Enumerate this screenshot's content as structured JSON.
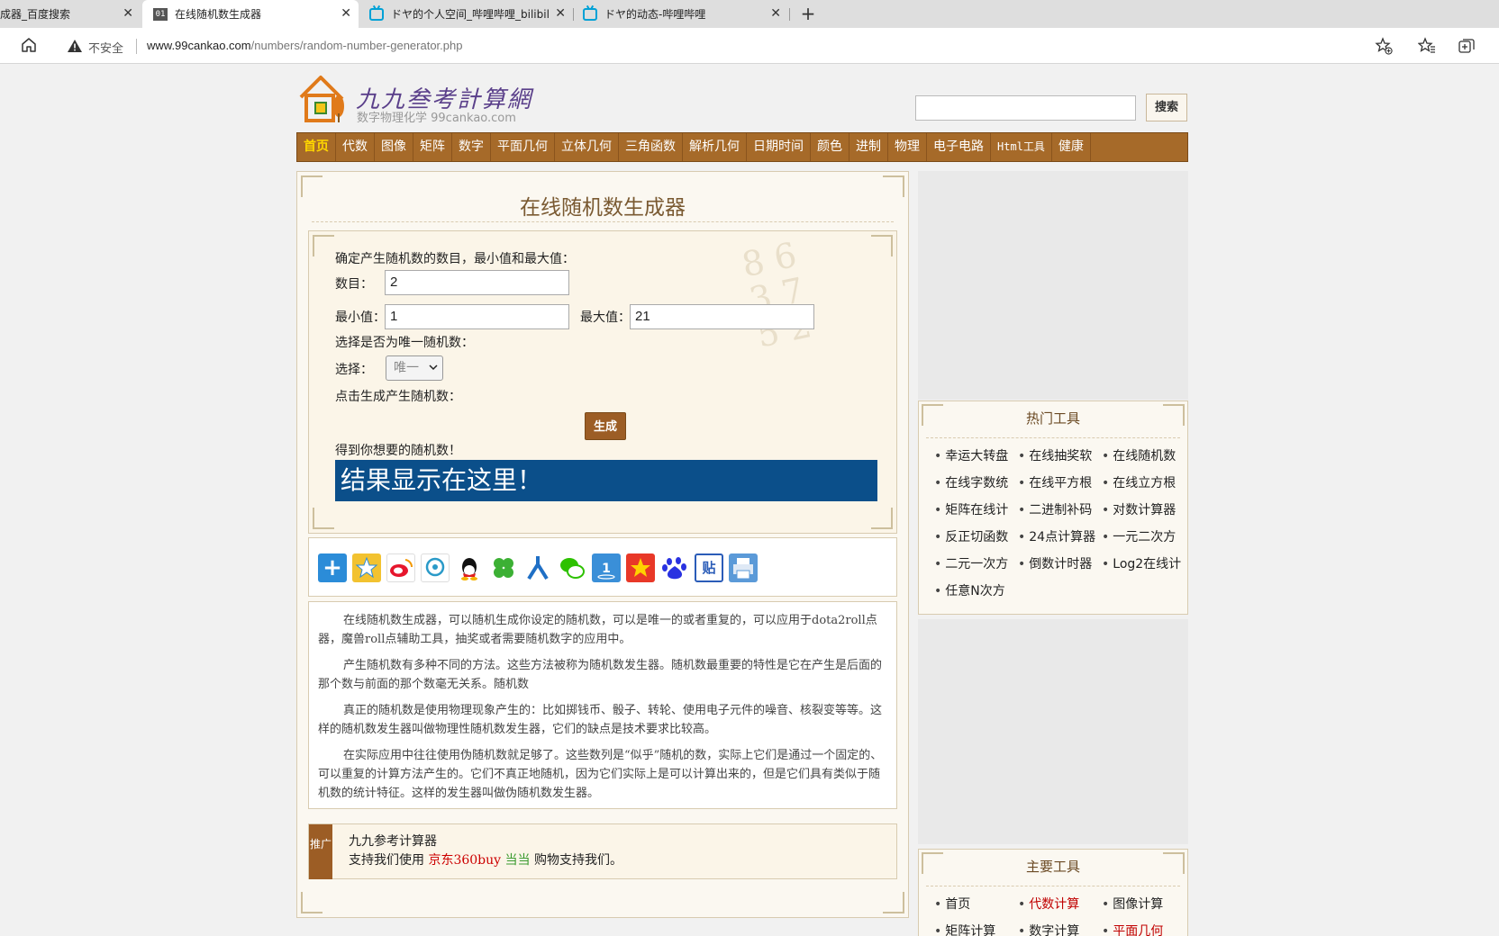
{
  "browser": {
    "tabs": [
      {
        "title": "生成器_百度搜索",
        "active": false
      },
      {
        "title": "在线随机数生成器",
        "active": true
      },
      {
        "title": "ドヤ的个人空间_哔哩哔哩_bilibili",
        "active": false
      },
      {
        "title": "ドヤ的动态-哔哩哔哩",
        "active": false
      }
    ],
    "favicon_01": "01",
    "close_glyph": "✕",
    "new_tab_glyph": "+",
    "security_label": "不安全",
    "url_host": "www.99cankao.com",
    "url_path": "/numbers/random-number-generator.php"
  },
  "site": {
    "logo_title": "九九叁考計算網",
    "logo_sub": "数字物理化学 99cankao.com",
    "search_placeholder": "",
    "search_button": "搜索",
    "nav": [
      "首页",
      "代数",
      "图像",
      "矩阵",
      "数字",
      "平面几何",
      "立体几何",
      "三角函数",
      "解析几何",
      "日期时间",
      "颜色",
      "进制",
      "物理",
      "电子电路",
      "Html工具",
      "健康"
    ],
    "nav_active_index": 0
  },
  "main": {
    "title": "在线随机数生成器",
    "intro": "确定产生随机数的数目，最小值和最大值：",
    "count_label": "数目：",
    "count_value": "2",
    "min_label": "最小值：",
    "min_value": "1",
    "max_label": "最大值：",
    "max_value": "21",
    "unique_question": "选择是否为唯一随机数：",
    "select_label": "选择：",
    "select_value": "唯一",
    "click_prompt": "点击生成产生随机数：",
    "generate_button": "生成",
    "result_label": "得到你想要的随机数！",
    "result_text": "结果显示在这里！",
    "share_icons": [
      "share-plus-icon",
      "qzone-icon",
      "weibo-icon",
      "tencent-weibo-icon",
      "qq-icon",
      "clover-icon",
      "renren-icon",
      "wechat-icon",
      "counter-icon",
      "star-icon",
      "baidu-icon",
      "tieba-icon",
      "print-icon"
    ],
    "tieba_glyph": "贴",
    "paragraphs": [
      "在线随机数生成器，可以随机生成你设定的随机数，可以是唯一的或者重复的，可以应用于dota2roll点器，魔兽roll点辅助工具，抽奖或者需要随机数字的应用中。",
      "产生随机数有多种不同的方法。这些方法被称为随机数发生器。随机数最重要的特性是它在产生是后面的那个数与前面的那个数毫无关系。随机数",
      "真正的随机数是使用物理现象产生的：比如掷钱币、骰子、转轮、使用电子元件的噪音、核裂变等等。这样的随机数发生器叫做物理性随机数发生器，它们的缺点是技术要求比较高。",
      "在实际应用中往往使用伪随机数就足够了。这些数列是“似乎”随机的数，实际上它们是通过一个固定的、可以重复的计算方法产生的。它们不真正地随机，因为它们实际上是可以计算出来的，但是它们具有类似于随机数的统计特征。这样的发生器叫做伪随机数发生器。"
    ],
    "promo_tag": "推广",
    "promo_name": "九九参考计算器",
    "promo_prefix": "支持我们使用",
    "promo_jd": "京东360buy",
    "promo_dd": "当当",
    "promo_suffix": "购物支持我们。"
  },
  "sidebar": {
    "hot_title": "热门工具",
    "hot_items": [
      "幸运大转盘",
      "在线抽奖软",
      "在线随机数",
      "在线字数统",
      "在线平方根",
      "在线立方根",
      "矩阵在线计",
      "二进制补码",
      "对数计算器",
      "反正切函数",
      "24点计算器",
      "一元二次方",
      "二元一次方",
      "倒数计时器",
      "Log2在线计",
      "任意N次方"
    ],
    "main_title": "主要工具",
    "main_items": [
      "首页",
      "代数计算",
      "图像计算",
      "矩阵计算",
      "数字计算",
      "平面几何"
    ],
    "main_red_indices": [
      1,
      5
    ]
  },
  "colors": {
    "nav_bg": "#a66a29",
    "nav_active": "#ffd700",
    "result_bg": "#0b4f8a",
    "button_brown": "#9c5d25"
  }
}
